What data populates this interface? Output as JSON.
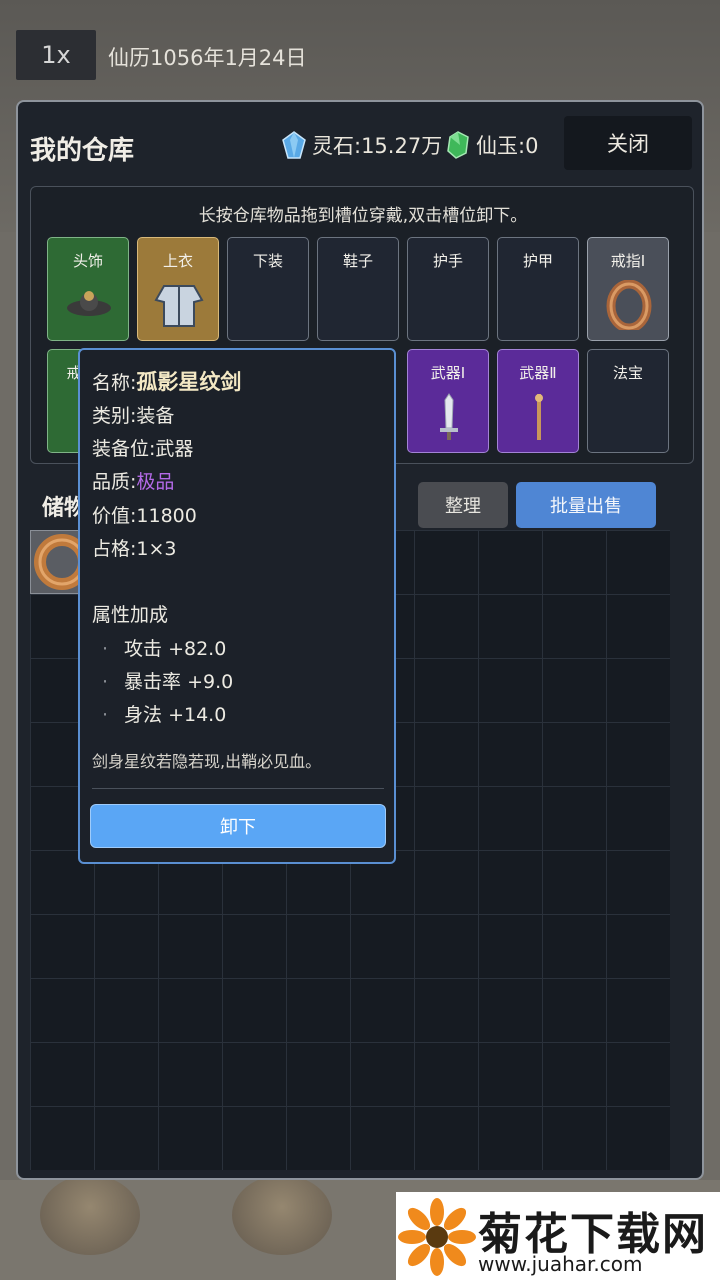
{
  "topbar": {
    "speed": "1x",
    "date": "仙历1056年1月24日"
  },
  "panel": {
    "title": "我的仓库",
    "spirit_stone_label": "灵石:15.27万",
    "jade_label": "仙玉:0",
    "close_label": "关闭",
    "hint": "长按仓库物品拖到槽位穿戴,双击槽位卸下。"
  },
  "slots": {
    "head": "头饰",
    "top": "上衣",
    "bottom": "下装",
    "shoes": "鞋子",
    "gloves": "护手",
    "armor": "护甲",
    "ring1": "戒指Ⅰ",
    "ring2": "戒",
    "weapon1": "武器Ⅰ",
    "weapon2": "武器Ⅱ",
    "treasure": "法宝"
  },
  "storage": {
    "title": "储物",
    "sort_label": "整理",
    "sell_label": "批量出售"
  },
  "tooltip": {
    "name_key": "名称:",
    "name_val": "孤影星纹剑",
    "category": "类别:装备",
    "slot": "装备位:武器",
    "quality_key": "品质:",
    "quality_val": "极品",
    "value": "价值:11800",
    "size": "占格:1×3",
    "attr_title": "属性加成",
    "attrs": [
      "攻击 +82.0",
      "暴击率 +9.0",
      "身法 +14.0"
    ],
    "description": "剑身星纹若隐若现,出鞘必见血。",
    "unequip_label": "卸下"
  },
  "watermark": {
    "title": "菊花下载网",
    "url": "www.juahar.com"
  },
  "colors": {
    "green_slot": "#2e6a34",
    "gold_slot": "#9c7a3a",
    "purple_slot": "#5b2b99",
    "accent_blue": "#5aa6f5",
    "quality_purple": "#b46ae8"
  }
}
